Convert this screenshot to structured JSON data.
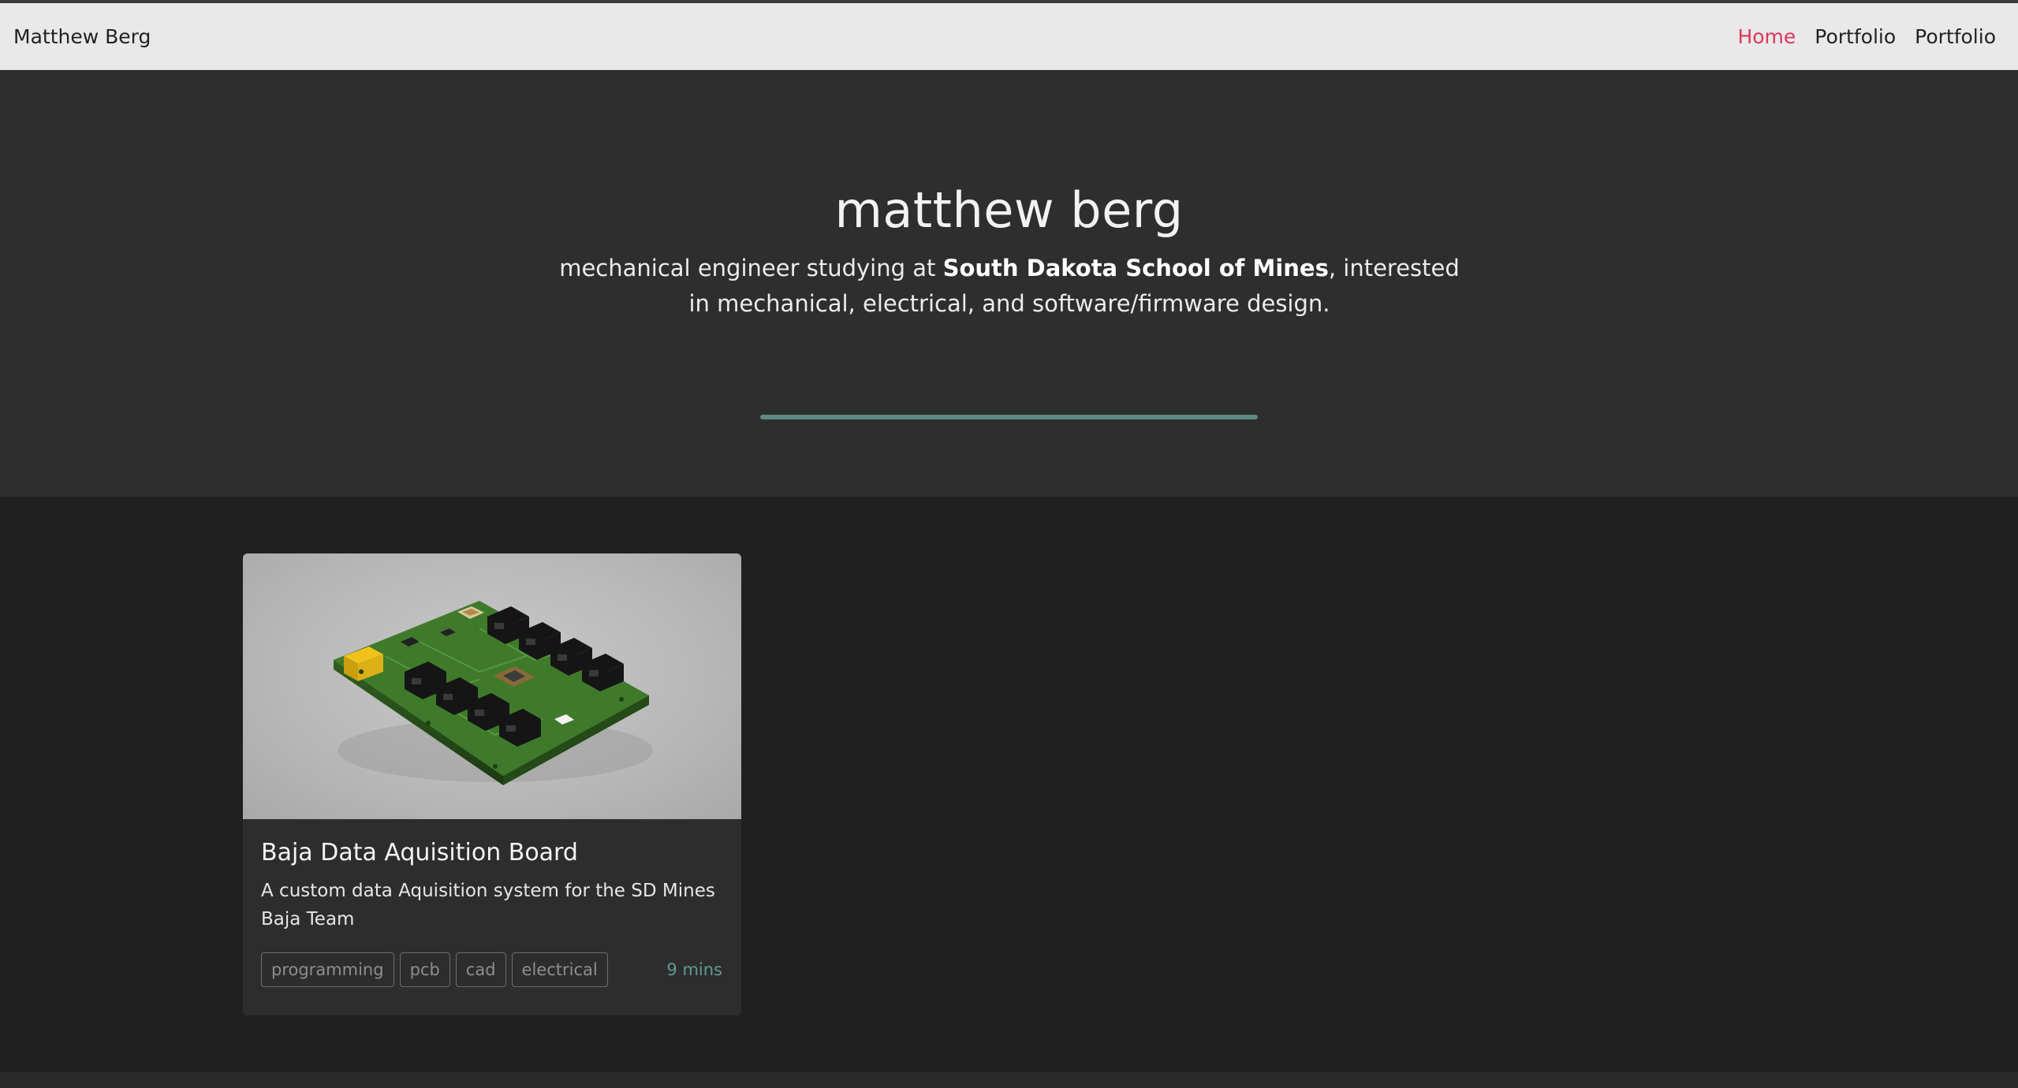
{
  "navbar": {
    "brand": "Matthew Berg",
    "links": [
      {
        "label": "Home",
        "active": true
      },
      {
        "label": "Portfolio",
        "active": false
      },
      {
        "label": "Portfolio",
        "active": false
      }
    ]
  },
  "hero": {
    "title": "matthew berg",
    "subtitle_pre": "mechanical engineer studying at ",
    "subtitle_bold": "South Dakota School of Mines",
    "subtitle_post": ", interested in mechanical, electrical, and software/firmware design."
  },
  "cards": [
    {
      "image_icon": "pcb-render-image",
      "title": "Baja Data Aquisition Board",
      "description": "A custom data Aquisition system for the SD Mines Baja Team",
      "tags": [
        "programming",
        "pcb",
        "cad",
        "electrical"
      ],
      "read_time": "9 mins"
    }
  ],
  "colors": {
    "accent_active": "#e0365c",
    "hero_rule": "#5f8a84",
    "read_time": "#5f9a92"
  }
}
